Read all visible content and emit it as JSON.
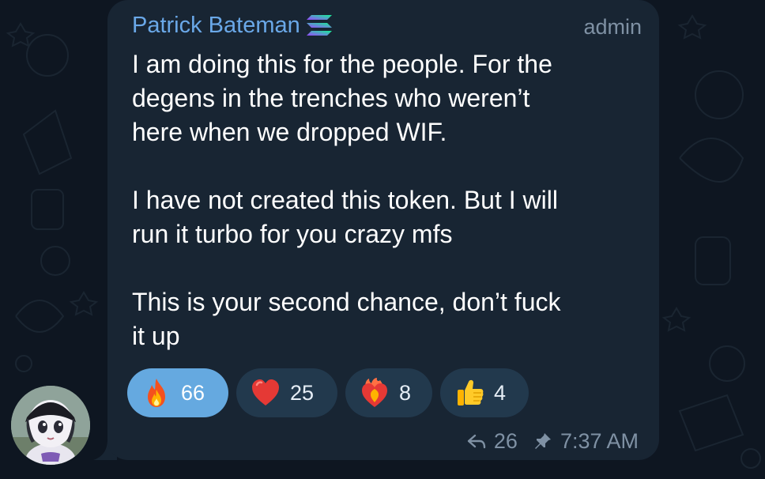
{
  "message": {
    "sender_name": "Patrick Bateman",
    "sender_badge_icon": "solana-logo-icon",
    "role_label": "admin",
    "paragraphs": [
      "I am doing this for the people. For the\ndegens in the trenches who weren’t\nhere when we dropped WIF.",
      "I have not created this token. But I will\nrun it turbo for you crazy mfs",
      "This is your second chance, don’t fuck\nit up"
    ],
    "reactions": [
      {
        "icon": "fire-emoji-icon",
        "count": "66",
        "active": true
      },
      {
        "icon": "red-heart-emoji-icon",
        "count": "25",
        "active": false
      },
      {
        "icon": "heart-on-fire-emoji-icon",
        "count": "8",
        "active": false
      },
      {
        "icon": "thumbs-up-emoji-icon",
        "count": "4",
        "active": false
      }
    ],
    "forward_count": "26",
    "time": "7:37 AM"
  },
  "colors": {
    "background": "#0e1621",
    "bubble": "#182533",
    "sender_name": "#6aa8e8",
    "active_reaction": "#65a9e0",
    "inactive_reaction": "#22394d",
    "meta_text": "#7f91a4"
  }
}
